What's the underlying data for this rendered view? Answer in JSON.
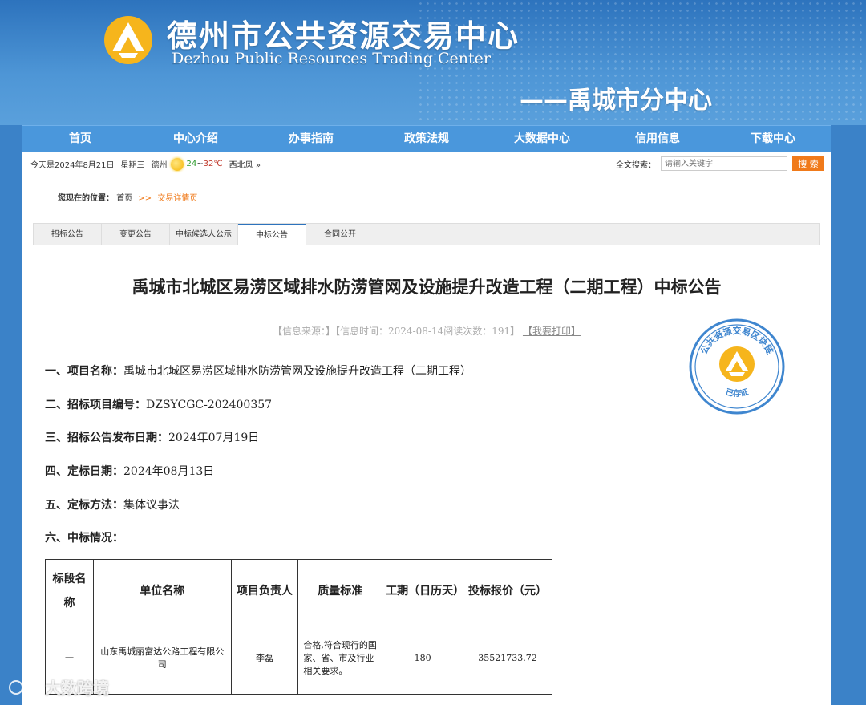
{
  "header": {
    "title": "德州市公共资源交易中心",
    "subtitle": "Dezhou Public Resources Trading Center",
    "branch": "——禹城市分中心"
  },
  "nav": {
    "items": [
      "首页",
      "中心介绍",
      "办事指南",
      "政策法规",
      "大数据中心",
      "信用信息",
      "下载中心"
    ]
  },
  "infobar": {
    "date": "今天是2024年8月21日",
    "weekday": "星期三",
    "city": "德州",
    "temp_low": "24",
    "temp_sep": "~",
    "temp_high": "32℃",
    "wind": "西北风 »",
    "search_label": "全文搜索：",
    "search_placeholder": "请输入关键字",
    "search_button": "搜 索"
  },
  "breadcrumb": {
    "label": "您现在的位置：",
    "home": "首页",
    "sep": ">>",
    "current": "交易详情页"
  },
  "tabs": [
    "招标公告",
    "变更公告",
    "中标候选人公示",
    "中标公告",
    "合同公开"
  ],
  "active_tab_index": 3,
  "doc": {
    "title": "禹城市北城区易涝区域排水防涝管网及设施提升改造工程（二期工程）中标公告",
    "meta_prefix": "【信息来源：】【信息时间：2024-08-14阅读次数：191】",
    "meta_print": "【我要打印】",
    "stamp_text": "公共资源交易区块链",
    "stamp_bottom": "已存证",
    "lines": [
      {
        "key": "一、项目名称：",
        "value": "禹城市北城区易涝区域排水防涝管网及设施提升改造工程（二期工程）"
      },
      {
        "key": "二、招标项目编号：",
        "value": "DZSYCGC-202400357"
      },
      {
        "key": "三、招标公告发布日期：",
        "value": "2024年07月19日"
      },
      {
        "key": "四、定标日期：",
        "value": "2024年08月13日"
      },
      {
        "key": "五、定标方法：",
        "value": "集体议事法"
      },
      {
        "key": "六、中标情况：",
        "value": ""
      }
    ],
    "table": {
      "headers": [
        "标段名称",
        "单位名称",
        "项目负责人",
        "质量标准",
        "工期（日历天）",
        "投标报价（元）"
      ],
      "rows": [
        [
          "一",
          "山东禹城丽富达公路工程有限公司",
          "李磊",
          "合格,符合现行的国家、省、市及行业相关要求。",
          "180",
          "35521733.72"
        ]
      ]
    }
  },
  "watermark": "大数跨境",
  "colors": {
    "nav_bg": "#4a97dc",
    "accent": "#f07a1a",
    "stamp": "#3f86cf"
  }
}
